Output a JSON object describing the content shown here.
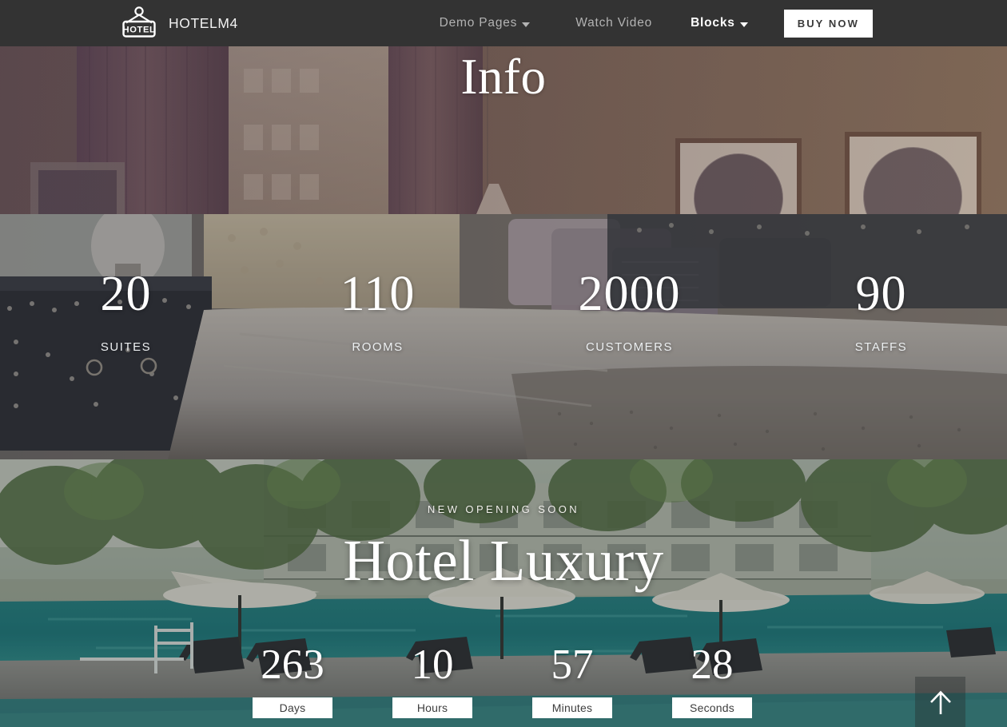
{
  "navbar": {
    "logo_icon": "hotel-sign-icon",
    "logo_text": "HOTEL",
    "brand": "HOTELM4",
    "links": [
      {
        "label": "Demo Pages",
        "caret": true,
        "bold": false
      },
      {
        "label": "Watch Video",
        "caret": false,
        "bold": false
      },
      {
        "label": "Blocks",
        "caret": true,
        "bold": true
      }
    ],
    "cta": "BUY NOW",
    "bg_color": "#333333",
    "link_color": "#b3b3b3",
    "active_color": "#ffffff"
  },
  "hero_info": {
    "title": "Info",
    "background": "hotel-room-curtains-lamp-artwork"
  },
  "counters": {
    "background": "luxury-bedroom-pillows-nightstand",
    "items": [
      {
        "value": "20",
        "label": "SUITES"
      },
      {
        "value": "110",
        "label": "ROOMS"
      },
      {
        "value": "2000",
        "label": "CUSTOMERS"
      },
      {
        "value": "90",
        "label": "STAFFS"
      }
    ]
  },
  "pool": {
    "background": "resort-swimming-pool-umbrellas-loungers",
    "kicker": "NEW OPENING SOON",
    "title": "Hotel Luxury",
    "countdown": [
      {
        "value": "263",
        "label": "Days"
      },
      {
        "value": "10",
        "label": "Hours"
      },
      {
        "value": "57",
        "label": "Minutes"
      },
      {
        "value": "28",
        "label": "Seconds"
      }
    ],
    "scroll_top_icon": "arrow-up-icon"
  }
}
